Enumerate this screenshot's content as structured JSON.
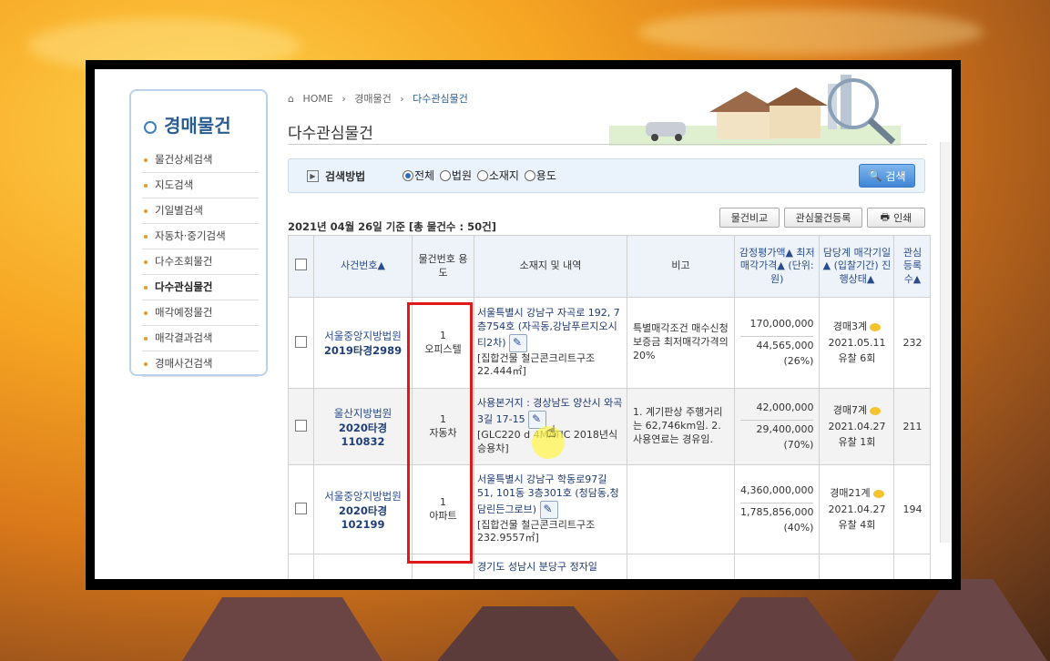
{
  "breadcrumb": [
    "HOME",
    "경매물건",
    "다수관심물건"
  ],
  "sidebar": {
    "title": "경매물건",
    "items": [
      {
        "label": "물건상세검색"
      },
      {
        "label": "지도검색"
      },
      {
        "label": "기일별검색"
      },
      {
        "label": "자동차·중기검색"
      },
      {
        "label": "다수조회물건"
      },
      {
        "label": "다수관심물건"
      },
      {
        "label": "매각예정물건"
      },
      {
        "label": "매각결과검색"
      },
      {
        "label": "경매사건검색"
      }
    ]
  },
  "page_title": "다수관심물건",
  "search": {
    "label": "검색방법",
    "options": [
      "전체",
      "법원",
      "소재지",
      "용도"
    ],
    "selected": "전체",
    "button": "검색"
  },
  "summary": "2021년 04월 26일 기준 [총 물건수 : 50건]",
  "buttons": {
    "compare": "물건비교",
    "register": "관심물건등록",
    "print": "인쇄"
  },
  "table": {
    "headers": {
      "case": "사건번호▲",
      "item_no": "물건번호 용도",
      "location": "소재지 및 내역",
      "note": "비고",
      "price": "감정평가액▲ 최저매각가격▲ (단위:원)",
      "dept": "담당계 매각기일▲ (입찰기간) 진행상태▲",
      "count": "관심 등록 수▲"
    },
    "rows": [
      {
        "court": "서울중앙지방법원",
        "case_no": "2019타경2989",
        "item_no": "1",
        "usage": "오피스텔",
        "address": "서울특별시 강남구 자곡로 192, 7층754호 (자곡동,강남푸르지오시티2차)",
        "detail": "[집합건물 철근콘크리트구조 22.444㎡]",
        "note": "특별매각조건 매수신청보증금 최저매각가격의 20%",
        "appraisal": "170,000,000",
        "minimum": "44,565,000",
        "ratio": "(26%)",
        "dept": "경매3계",
        "date": "2021.05.11",
        "status": "유찰 6회",
        "count": "232"
      },
      {
        "court": "울산지방법원",
        "case_no": "2020타경110832",
        "item_no": "1",
        "usage": "자동차",
        "address": "사용본거지 : 경상남도 양산시 와곡3길 17-15",
        "detail": "[GLC220 d 4MATIC 2018년식 승용차]",
        "note": "1. 계기판상 주행거리는 62,746km임. 2. 사용연료는 경유임.",
        "appraisal": "42,000,000",
        "minimum": "29,400,000",
        "ratio": "(70%)",
        "dept": "경매7계",
        "date": "2021.04.27",
        "status": "유찰 1회",
        "count": "211"
      },
      {
        "court": "서울중앙지방법원",
        "case_no": "2020타경102199",
        "item_no": "1",
        "usage": "아파트",
        "address": "서울특별시 강남구 학동로97길 51, 101동 3층301호 (청담동,청담린든그로브)",
        "detail": "[집합건물 철근콘크리트구조 232.9557㎡]",
        "note": "",
        "appraisal": "4,360,000,000",
        "minimum": "1,785,856,000",
        "ratio": "(40%)",
        "dept": "경매21계",
        "date": "2021.04.27",
        "status": "유찰 4회",
        "count": "194"
      },
      {
        "court": "",
        "case_no": "",
        "item_no": "",
        "usage": "",
        "address": "경기도 성남시 분당구 정자일",
        "detail": "",
        "note": "",
        "appraisal": "",
        "minimum": "",
        "ratio": "",
        "dept": "",
        "date": "",
        "status": "",
        "count": ""
      }
    ]
  },
  "colors": {
    "accent": "#2a5d8f",
    "highlight_box": "#e01818",
    "sunset": "#f6a623"
  }
}
